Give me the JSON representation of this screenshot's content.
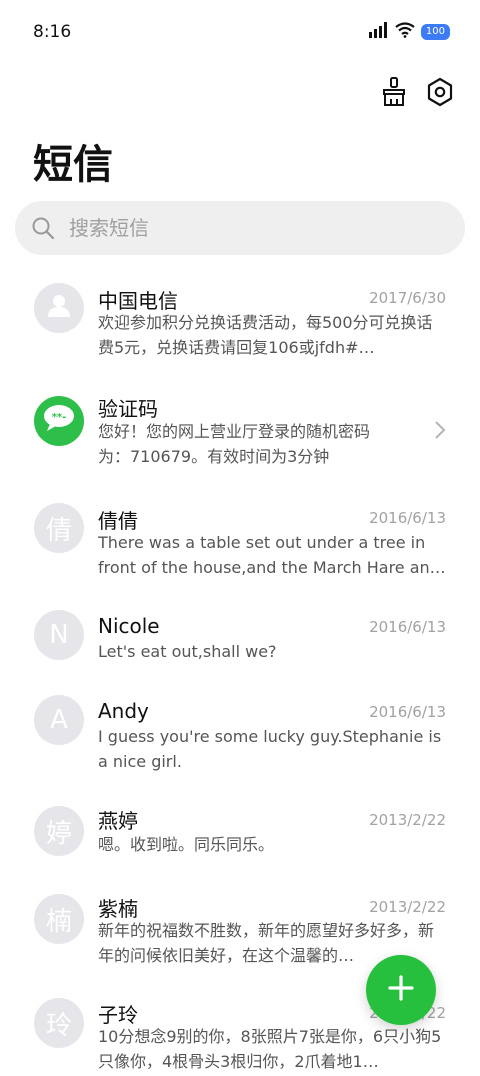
{
  "status_bar": {
    "time": "8:16",
    "battery": "100"
  },
  "header": {
    "title": "短信"
  },
  "search": {
    "placeholder": "搜索短信"
  },
  "conversations": [
    {
      "name": "中国电信",
      "date": "2017/6/30",
      "preview": "欢迎参加积分兑换话费活动，每500分可兑换话费5元，兑换话费请回复106或jfdh#…",
      "avatar_text": "",
      "avatar_icon": "person-icon"
    },
    {
      "name": "验证码",
      "date": "",
      "preview": "您好！您的网上营业厅登录的随机密码为：710679。有效时间为3分钟",
      "avatar_text": "",
      "avatar_icon": "message-bubble-icon"
    },
    {
      "name": "倩倩",
      "date": "2016/6/13",
      "preview": "There was a table set out under a tree in front of the house,and the March Hare and the H…",
      "avatar_text": "倩"
    },
    {
      "name": "Nicole",
      "date": "2016/6/13",
      "preview": "Let's eat out,shall we?",
      "avatar_text": "N"
    },
    {
      "name": "Andy",
      "date": "2016/6/13",
      "preview": "I guess you're some lucky guy.Stephanie is a nice girl.",
      "avatar_text": "A"
    },
    {
      "name": "燕婷",
      "date": "2013/2/22",
      "preview": "嗯。收到啦。同乐同乐。",
      "avatar_text": "婷"
    },
    {
      "name": "紫楠",
      "date": "2013/2/22",
      "preview": "新年的祝福数不胜数，新年的愿望好多好多，新年的问候依旧美好，在这个温馨的…",
      "avatar_text": "楠"
    },
    {
      "name": "子玲",
      "date": "2013/2/22",
      "preview": "10分想念9别的你，8张照片7张是你，6只小狗5只像你，4根骨头3根归你，2爪着地1…",
      "avatar_text": "玲"
    }
  ],
  "colors": {
    "accent_green": "#26c03e",
    "avatar_gray": "#e5e5ea",
    "battery_blue": "#3c7bf6"
  }
}
